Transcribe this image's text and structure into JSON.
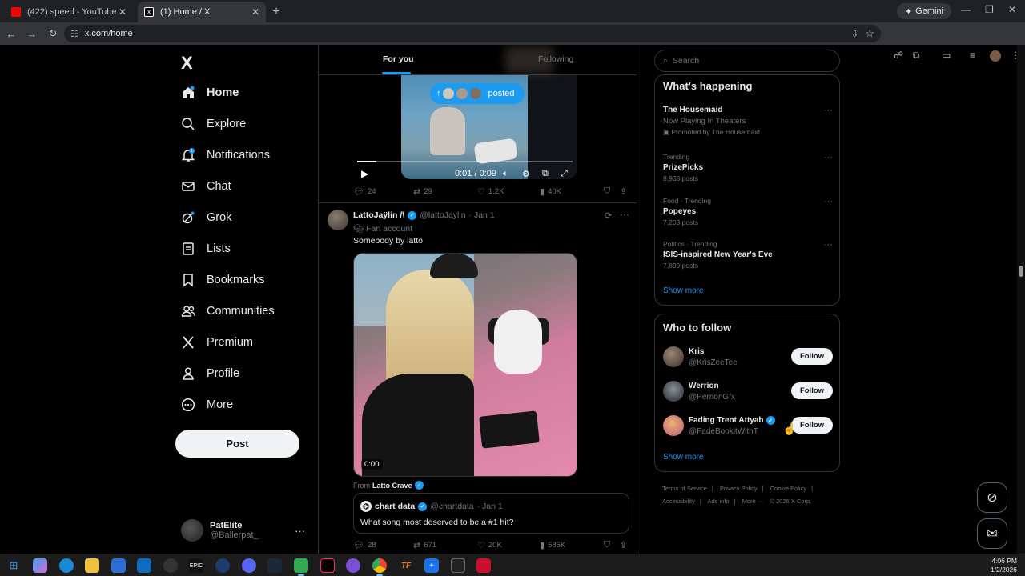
{
  "browser": {
    "tabs": [
      {
        "title": "(422) speed - YouTube",
        "favicon_color": "#ff0000",
        "active": false
      },
      {
        "title": "(1) Home / X",
        "favicon_color": "#ffffff",
        "active": true
      }
    ],
    "new_tab_icon": "plus-icon",
    "gemini_label": "Gemini",
    "url": "x.com/home"
  },
  "sidebar": {
    "logo": "X",
    "items": [
      {
        "label": "Home",
        "icon": "home-icon",
        "glyph": "⌂",
        "bold": true
      },
      {
        "label": "Explore",
        "icon": "search-icon",
        "glyph": "⌕"
      },
      {
        "label": "Notifications",
        "icon": "bell-icon",
        "glyph": "🔔",
        "badge": "1"
      },
      {
        "label": "Chat",
        "icon": "mail-icon",
        "glyph": "✉"
      },
      {
        "label": "Grok",
        "icon": "grok-icon",
        "glyph": "⊘"
      },
      {
        "label": "Lists",
        "icon": "list-icon",
        "glyph": "▤"
      },
      {
        "label": "Bookmarks",
        "icon": "bookmark-icon",
        "glyph": "⛉"
      },
      {
        "label": "Communities",
        "icon": "people-icon",
        "glyph": "👥"
      },
      {
        "label": "Premium",
        "icon": "x-logo-icon",
        "glyph": "𝕏"
      },
      {
        "label": "Profile",
        "icon": "person-icon",
        "glyph": "👤"
      },
      {
        "label": "More",
        "icon": "more-circle-icon",
        "glyph": "⋯"
      }
    ],
    "post_label": "Post",
    "account": {
      "name": "PatElite",
      "handle": "@Ballerpat_"
    }
  },
  "feed": {
    "tabs": [
      {
        "label": "For you",
        "active": true
      },
      {
        "label": "Following",
        "active": false
      }
    ],
    "posted_pill": "posted",
    "video": {
      "time": "0:01 / 0:09",
      "progress": 0.09
    },
    "tweet1_actions": {
      "replies": "24",
      "reposts": "29",
      "likes": "1.2K",
      "views": "40K"
    },
    "tweet2": {
      "name": "LattoJaÿlin /\\",
      "handle": "@lattoJaylin",
      "date": "· Jan 1",
      "label": "Fan account",
      "text": "Somebody by latto",
      "media_time": "0:00",
      "from_prefix": "From",
      "from_name": "Latto Crave",
      "quote": {
        "name": "chart data",
        "handle": "@chartdata",
        "date": "· Jan 1",
        "text": "What song most deserved to be a #1 hit?"
      },
      "actions": {
        "replies": "28",
        "reposts": "671",
        "likes": "20K",
        "views": "585K"
      }
    }
  },
  "right": {
    "search_placeholder": "Search",
    "happening_title": "What's happening",
    "trends": [
      {
        "context": "",
        "title": "The Housemaid",
        "subtitle": "Now Playing In Theaters",
        "count": "Promoted by The Housemaid"
      },
      {
        "context": "Trending",
        "title": "PrizePicks",
        "subtitle": "",
        "count": "8,938 posts"
      },
      {
        "context": "Food · Trending",
        "title": "Popeyes",
        "subtitle": "",
        "count": "7,203 posts"
      },
      {
        "context": "Politics · Trending",
        "title": "ISIS-inspired New Year's Eve",
        "subtitle": "",
        "count": "7,899 posts"
      }
    ],
    "show_more": "Show more",
    "who_title": "Who to follow",
    "who": [
      {
        "name": "Kris",
        "handle": "@KrisZeeTee",
        "verified": false,
        "avatar_color": "#6b5a4e"
      },
      {
        "name": "Werrion",
        "handle": "@PerrionGfx",
        "verified": false,
        "avatar_color": "#4a4f55"
      },
      {
        "name": "Fading Trent Attyah",
        "handle": "@FadeBookitWithT",
        "verified": true,
        "avatar_color": "#c98a4a"
      }
    ],
    "follow_label": "Follow",
    "footer": [
      "Terms of Service",
      "|",
      "Privacy Policy",
      "|",
      "Cookie Policy",
      "|",
      "Accessibility",
      "|",
      "Ads info",
      "|",
      "More ···",
      "© 2026 X Corp."
    ]
  },
  "taskbar": {
    "time": "4:06 PM",
    "date": "1/2/2026"
  }
}
